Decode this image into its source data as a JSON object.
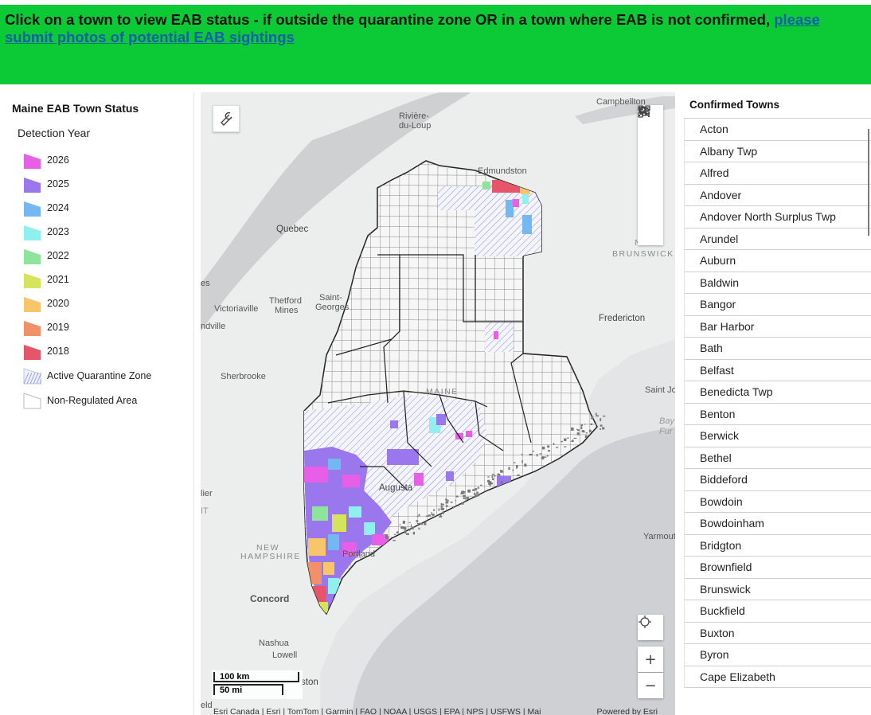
{
  "banner": {
    "text": "Click on a town to view EAB status - if outside the quarantine zone OR in a town where EAB is not confirmed, ",
    "link": "please submit photos of potential EAB sightings",
    "bg_color": "#0cc936"
  },
  "legend": {
    "title": "Maine EAB Town Status",
    "subtitle": "Detection Year",
    "items": [
      {
        "label": "2026",
        "color": "#e65fe6"
      },
      {
        "label": "2025",
        "color": "#9b77ee"
      },
      {
        "label": "2024",
        "color": "#74b8f2"
      },
      {
        "label": "2023",
        "color": "#8ff0ef"
      },
      {
        "label": "2022",
        "color": "#8ee49a"
      },
      {
        "label": "2021",
        "color": "#d5e35d"
      },
      {
        "label": "2020",
        "color": "#f7c66a"
      },
      {
        "label": "2019",
        "color": "#f0916a"
      },
      {
        "label": "2018",
        "color": "#e5566b"
      }
    ],
    "quarantine_label": "Active Quarantine Zone",
    "nonreg_label": "Non-Regulated Area"
  },
  "map": {
    "labels": {
      "campbellton": "Campbellton",
      "riviere": "Rivière-",
      "duloup": "du-Loup",
      "edmundston": "Edmundston",
      "quebec": "Quebec",
      "new": "NEW",
      "brunswick": "BRUNSWICK",
      "es": "es",
      "victoriaville": "Victoriaville",
      "thetford": "Thetford",
      "mines": "Mines",
      "saint": "Saint-",
      "georges": "Georges",
      "ndville": "ndville",
      "fredericton": "Fredericton",
      "sherbrooke": "Sherbrooke",
      "maine": "MAINE",
      "saintjohn": "Saint Jo",
      "bay": "Bay",
      "fur": "Fur",
      "augusta": "Augusta",
      "lier": "lier",
      "it": "IT",
      "nh1": "NEW",
      "nh2": "HAMPSHIRE",
      "portland": "Portland",
      "yarmouth": "Yarmout",
      "concord": "Concord",
      "nashua": "Nashua",
      "lowell": "Lowell",
      "ston": "ston",
      "eld": "eld"
    },
    "scale_km": "100 km",
    "scale_mi": "50 mi",
    "attribution": "Esri Canada | Esri | TomTom | Garmin | FAO | NOAA | USGS | EPA | NPS | USFWS | Mai",
    "powered": "Powered by Esri",
    "zoom_in": "+",
    "zoom_out": "−"
  },
  "towns": {
    "title": "Confirmed Towns",
    "items": [
      "Acton",
      "Albany Twp",
      "Alfred",
      "Andover",
      "Andover North Surplus Twp",
      "Arundel",
      "Auburn",
      "Baldwin",
      "Bangor",
      "Bar Harbor",
      "Bath",
      "Belfast",
      "Benedicta Twp",
      "Benton",
      "Berwick",
      "Bethel",
      "Biddeford",
      "Bowdoin",
      "Bowdoinham",
      "Bridgton",
      "Brownfield",
      "Brunswick",
      "Buckfield",
      "Buxton",
      "Byron",
      "Cape Elizabeth"
    ]
  }
}
